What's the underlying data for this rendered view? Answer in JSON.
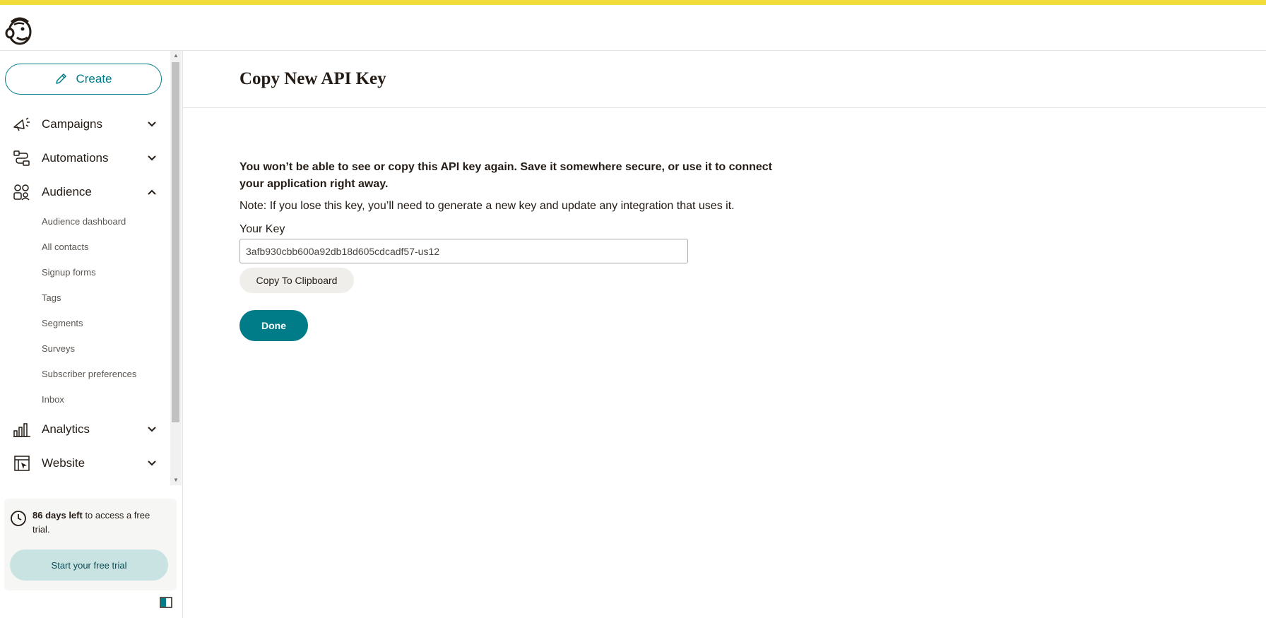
{
  "colors": {
    "brand_yellow": "#f2dc3c",
    "teal": "#007c89",
    "trial_button_bg": "#c9e3e3"
  },
  "header": {
    "logo_icon": "mailchimp-freddie-logo"
  },
  "sidebar": {
    "create_label": "Create",
    "create_icon": "pencil-icon",
    "items": [
      {
        "label": "Campaigns",
        "icon": "megaphone-icon",
        "expanded": false
      },
      {
        "label": "Automations",
        "icon": "automation-flow-icon",
        "expanded": false
      },
      {
        "label": "Audience",
        "icon": "audience-icon",
        "expanded": true
      },
      {
        "label": "Analytics",
        "icon": "bar-chart-icon",
        "expanded": false
      },
      {
        "label": "Website",
        "icon": "website-icon",
        "expanded": false
      }
    ],
    "audience_subitems": [
      "Audience dashboard",
      "All contacts",
      "Signup forms",
      "Tags",
      "Segments",
      "Surveys",
      "Subscriber preferences",
      "Inbox"
    ],
    "trial": {
      "days_left": "86 days left",
      "rest_text": " to access a free trial.",
      "button_label": "Start your free trial"
    }
  },
  "main": {
    "title": "Copy New API Key",
    "warning": "You won’t be able to see or copy this API key again. Save it somewhere secure, or use it to connect your application right away.",
    "note": "Note: If you lose this key, you’ll need to generate a new key and update any integration that uses it.",
    "key_label": "Your Key",
    "key_value": "3afb930cbb600a92db18d605cdcadf57-us12",
    "copy_label": "Copy To Clipboard",
    "done_label": "Done"
  }
}
